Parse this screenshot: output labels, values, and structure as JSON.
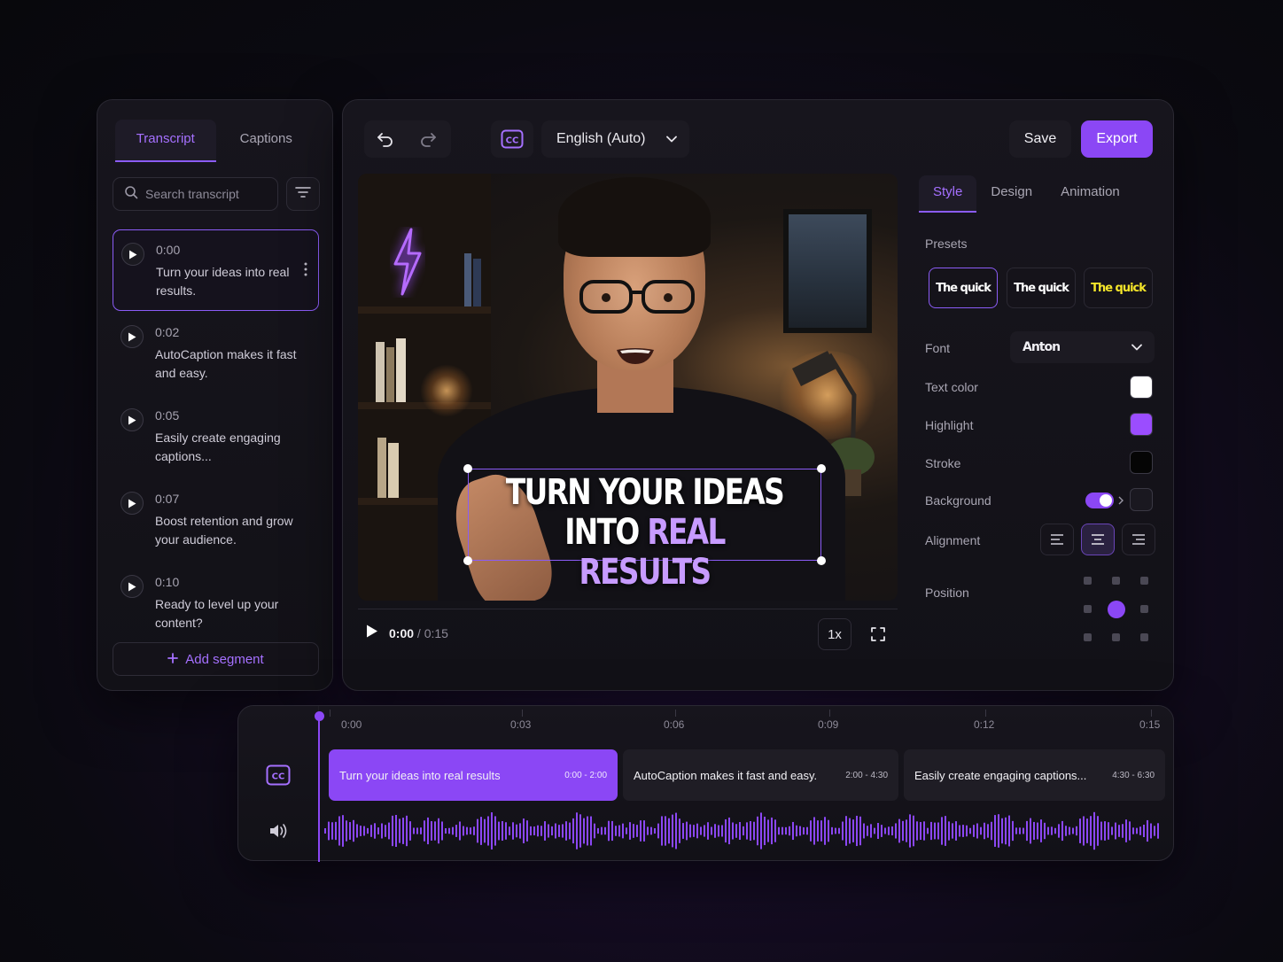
{
  "left": {
    "tabs": [
      {
        "label": "Transcript"
      },
      {
        "label": "Captions"
      }
    ],
    "search_placeholder": "Search transcript",
    "segments": [
      {
        "time": "0:00",
        "text": "Turn your ideas into real results."
      },
      {
        "time": "0:02",
        "text": "AutoCaption makes it fast and easy."
      },
      {
        "time": "0:05",
        "text": "Easily create engaging captions..."
      },
      {
        "time": "0:07",
        "text": "Boost retention and grow your audience."
      },
      {
        "time": "0:10",
        "text": "Ready to level up your content?"
      }
    ],
    "add_segment": "Add segment"
  },
  "toolbar": {
    "language": "English (Auto)",
    "save": "Save",
    "export": "Export"
  },
  "video": {
    "caption_line1": "TURN YOUR IDEAS",
    "caption_line2_plain": "INTO",
    "caption_line2_highlight": "REAL RESULTS",
    "current_time": "0:00",
    "duration": "/ 0:15",
    "speed": "1x"
  },
  "style_panel": {
    "tabs": [
      {
        "label": "Style"
      },
      {
        "label": "Design"
      },
      {
        "label": "Animation"
      }
    ],
    "presets_label": "Presets",
    "presets": [
      {
        "label": "The quick",
        "color": "#ffffff"
      },
      {
        "label": "The quick",
        "color": "#ffffff"
      },
      {
        "label": "The quick",
        "color": "#f5e62a"
      }
    ],
    "font_label": "Font",
    "font_value": "Anton",
    "text_color_label": "Text color",
    "text_color": "#ffffff",
    "highlight_label": "Highlight",
    "highlight_color": "#9b4dff",
    "stroke_label": "Stroke",
    "stroke_color": "#050505",
    "background_label": "Background",
    "background_enabled": true,
    "alignment_label": "Alignment",
    "alignment_selected": "center",
    "position_label": "Position",
    "position_selected": "center"
  },
  "timeline": {
    "ticks": [
      "0:00",
      "0:03",
      "0:06",
      "0:09",
      "0:12",
      "0:15"
    ],
    "clips": [
      {
        "text": "Turn your ideas into real results",
        "range": "0:00 - 2:00"
      },
      {
        "text": "AutoCaption makes it fast and easy.",
        "range": "2:00 - 4:30"
      },
      {
        "text": "Easily create engaging captions...",
        "range": "4:30 - 6:30"
      }
    ]
  },
  "colors": {
    "accent": "#8b47f5",
    "accent_text": "#a570ff"
  }
}
